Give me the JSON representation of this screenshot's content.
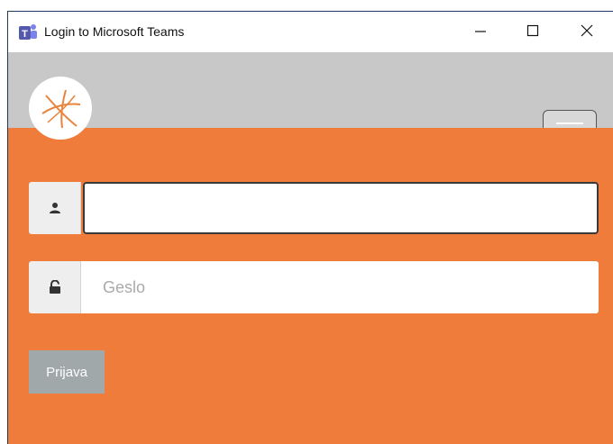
{
  "window": {
    "title": "Login to Microsoft Teams",
    "icon": "teams-icon",
    "controls": [
      "minimize-icon",
      "maximize-icon",
      "close-icon"
    ]
  },
  "header": {
    "logo": "logo-icon",
    "menu_icon": "hamburger-icon"
  },
  "form": {
    "username": {
      "value": "",
      "placeholder": "",
      "icon": "user-icon"
    },
    "password": {
      "value": "",
      "placeholder": "Geslo",
      "icon": "unlock-icon"
    },
    "submit_label": "Prijava"
  },
  "colors": {
    "accent": "#f07c3c",
    "header_bg": "#c8c8c8",
    "button_bg": "#a0a8aa"
  }
}
